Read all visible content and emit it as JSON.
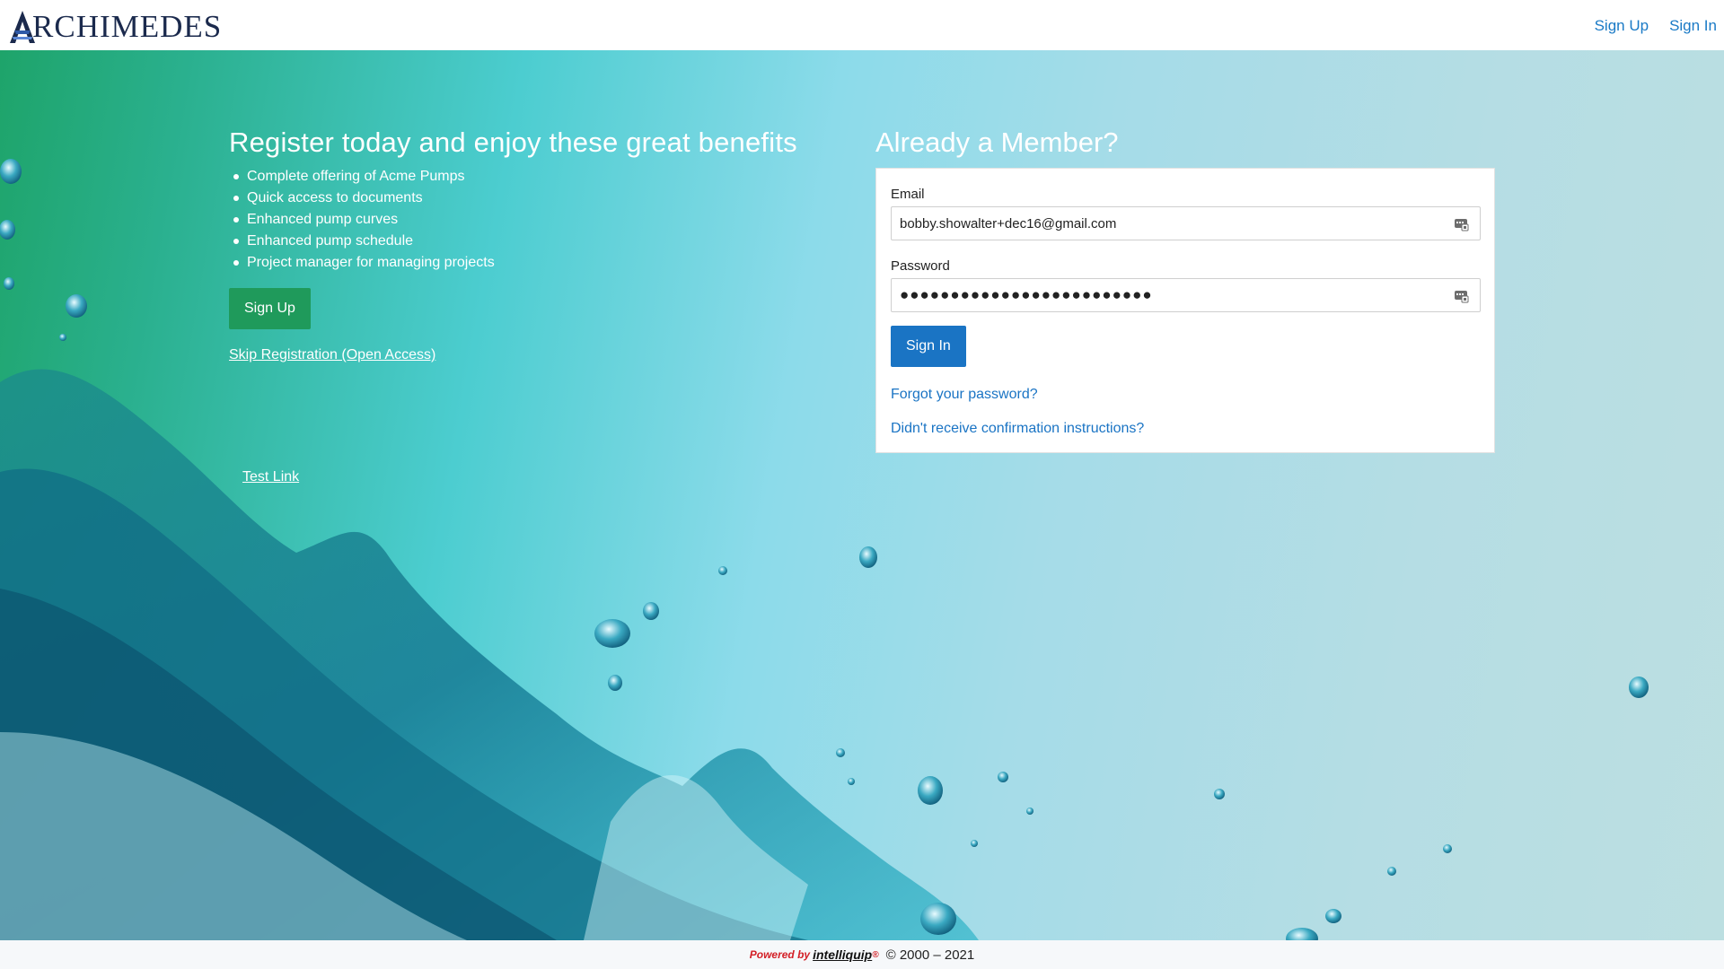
{
  "header": {
    "logo_text": "RCHIMEDES",
    "logo_mark": "A",
    "nav": [
      {
        "label": "Sign Up"
      },
      {
        "label": "Sign In"
      }
    ]
  },
  "register": {
    "title": "Register today and enjoy these great benefits",
    "benefits": [
      "Complete offering of Acme Pumps",
      "Quick access to documents",
      "Enhanced pump curves",
      "Enhanced pump schedule",
      "Project manager for managing projects"
    ],
    "signup_label": "Sign Up",
    "skip_label": "Skip Registration (Open Access)",
    "test_link_label": "Test Link"
  },
  "login": {
    "title": "Already a Member?",
    "email_label": "Email",
    "email_value": "bobby.showalter+dec16@gmail.com",
    "password_label": "Password",
    "password_value": "●●●●●●●●●●●●●●●●●●●●●●●●●",
    "signin_label": "Sign In",
    "forgot_label": "Forgot your password?",
    "confirm_label": "Didn't receive confirmation instructions?",
    "field_icon": "password-manager-icon"
  },
  "footer": {
    "powered_by": "Powered by",
    "brand": "intelliquip",
    "brand_mark": "®",
    "copyright": "© 2000 – 2021"
  },
  "colors": {
    "brand_blue": "#1a74c4",
    "signup_green": "#1f9a5b",
    "logo_navy": "#1b2a4d",
    "powered_red": "#d32027"
  }
}
